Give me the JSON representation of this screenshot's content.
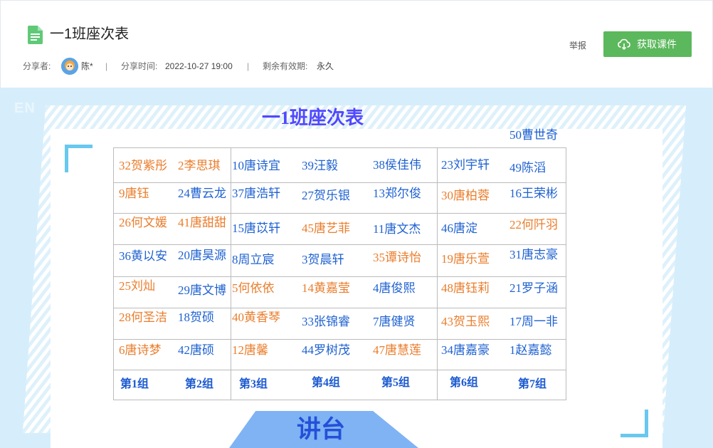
{
  "header": {
    "title": "一1班座次表",
    "sharer_label": "分享者:",
    "sharer_name": "陈*",
    "sep": "|",
    "share_time_label": "分享时间:",
    "share_time": "2022-10-27 19:00",
    "validity_label": "剩余有效期:",
    "validity": "永久",
    "report_label": "举报",
    "get_button_label": "获取课件",
    "accent_color": "#5cb85c"
  },
  "preview": {
    "badge": "EN",
    "sheet_title": "一1班座次表",
    "extra_name": "50曹世奇",
    "rows": [
      [
        "32贺紫彤",
        "2李思琪",
        "10唐诗宜",
        "39汪毅",
        "38侯佳伟",
        "23刘宇轩",
        "49陈滔"
      ],
      [
        "9唐钰",
        "24曹云龙",
        "37唐浩轩",
        "27贺乐银",
        "13郑尔俊",
        "30唐柏蓉",
        "16王荣彬"
      ],
      [
        "26何文媛",
        "41唐甜甜",
        "15唐苡轩",
        "45唐艺菲",
        "11唐文杰",
        "46唐淀",
        "22何阡羽"
      ],
      [
        "36黄以安",
        "20唐昊源",
        "8周立宸",
        "3贺晨轩",
        "35谭诗怡",
        "19唐乐萱",
        "31唐志豪"
      ],
      [
        "25刘灿",
        "29唐文博",
        "5何依依",
        "14黄嘉莹",
        "4唐俊熙",
        "48唐钰莉",
        "21罗子涵"
      ],
      [
        "28何圣洁",
        "18贺硕",
        "40黄香琴",
        "33张锦睿",
        "7唐健贤",
        "43贺玉熙",
        "17周一非"
      ],
      [
        "6唐诗梦",
        "42唐硕",
        "12唐馨",
        "44罗树茂",
        "47唐慧莲",
        "34唐嘉豪",
        "1赵嘉懿"
      ]
    ],
    "groups": [
      "第1组",
      "第2组",
      "第3组",
      "第4组",
      "第5组",
      "第6组",
      "第7组"
    ],
    "podium": "讲台"
  }
}
